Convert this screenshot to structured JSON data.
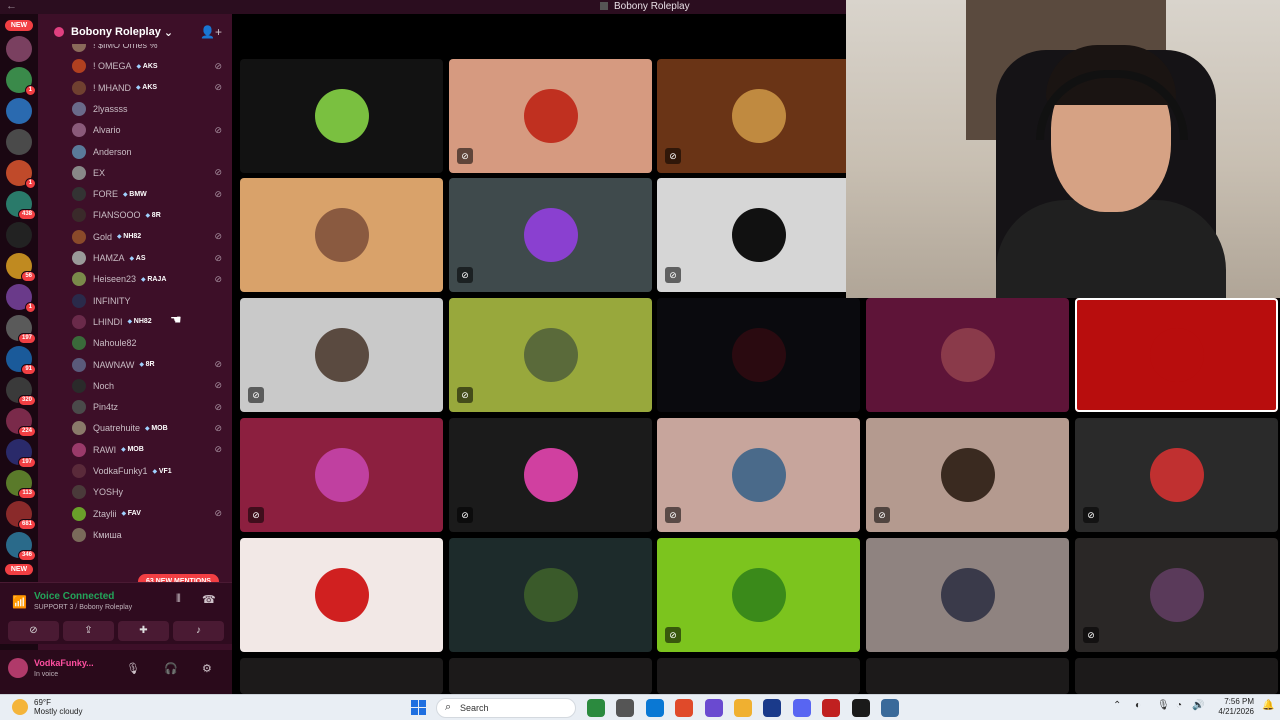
{
  "window": {
    "title": "Bobony Roleplay",
    "back_glyph": "←"
  },
  "server_rail": {
    "new_label_top": "NEW",
    "new_label_bottom": "NEW",
    "servers": [
      {
        "color": "#7a4060",
        "badge": ""
      },
      {
        "color": "#3a8a4a",
        "badge": "1"
      },
      {
        "color": "#2a6ab0",
        "badge": ""
      },
      {
        "color": "#4a4a4a",
        "badge": ""
      },
      {
        "color": "#c04a2a",
        "badge": "1"
      },
      {
        "color": "#2a7a6a",
        "badge": "438"
      },
      {
        "color": "#222222",
        "badge": ""
      },
      {
        "color": "#c08a20",
        "badge": "56"
      },
      {
        "color": "#6a3a8a",
        "badge": "1"
      },
      {
        "color": "#5a5a5a",
        "badge": "197"
      },
      {
        "color": "#1a5a9a",
        "badge": "91"
      },
      {
        "color": "#3a3a3a",
        "badge": "320"
      },
      {
        "color": "#7a2a4a",
        "badge": "224"
      },
      {
        "color": "#2a2a6a",
        "badge": "197"
      },
      {
        "color": "#5a7a2a",
        "badge": "113"
      },
      {
        "color": "#8a2a2a",
        "badge": "681"
      },
      {
        "color": "#2a6a8a",
        "badge": "346"
      }
    ]
  },
  "sidebar": {
    "server_name": "Bobony Roleplay",
    "members": [
      {
        "name": "! $IMO Ornes %",
        "tag": "",
        "muted": false,
        "color": "#8a6a5a"
      },
      {
        "name": "! OMEGA",
        "tag": "AKS",
        "muted": true,
        "color": "#b04020"
      },
      {
        "name": "! MHAND",
        "tag": "AKS",
        "muted": true,
        "color": "#704030"
      },
      {
        "name": "2lyassss",
        "tag": "",
        "muted": false,
        "color": "#6a6a8a"
      },
      {
        "name": "Alvario",
        "tag": "",
        "muted": true,
        "color": "#8a5a7a"
      },
      {
        "name": "Anderson",
        "tag": "",
        "muted": false,
        "color": "#5a7a9a"
      },
      {
        "name": "EX",
        "tag": "",
        "muted": true,
        "color": "#888888"
      },
      {
        "name": "FORE",
        "tag": "BMW",
        "muted": true,
        "color": "#333333"
      },
      {
        "name": "FIANSOOO",
        "tag": "8R",
        "muted": false,
        "color": "#3a2a2a"
      },
      {
        "name": "Gold",
        "tag": "NH82",
        "muted": true,
        "color": "#8a4a2a"
      },
      {
        "name": "HAMZA",
        "tag": "AS",
        "muted": true,
        "color": "#9a9a9a"
      },
      {
        "name": "Heiseen23",
        "tag": "RAJA",
        "muted": true,
        "color": "#7a8a4a"
      },
      {
        "name": "INFINITY",
        "tag": "",
        "muted": false,
        "color": "#2a2a4a"
      },
      {
        "name": "LHINDI",
        "tag": "NH82",
        "muted": false,
        "color": "#6a2a4a"
      },
      {
        "name": "Nahoule82",
        "tag": "",
        "muted": false,
        "color": "#3a6a3a"
      },
      {
        "name": "NAWNAW",
        "tag": "8R",
        "muted": true,
        "color": "#5a5a7a"
      },
      {
        "name": "Noch",
        "tag": "",
        "muted": true,
        "color": "#2a2a2a"
      },
      {
        "name": "Pin4tz",
        "tag": "",
        "muted": true,
        "color": "#4a4a4a"
      },
      {
        "name": "Quatrehuite",
        "tag": "MOB",
        "muted": true,
        "color": "#8a7a6a"
      },
      {
        "name": "RAWI",
        "tag": "MOB",
        "muted": true,
        "color": "#9a3a6a"
      },
      {
        "name": "VodkaFunky1",
        "tag": "VF1",
        "muted": false,
        "color": "#5a2a3a"
      },
      {
        "name": "YOSHy",
        "tag": "",
        "muted": false,
        "color": "#4a3a3a"
      },
      {
        "name": "Ztaylii",
        "tag": "FAV",
        "muted": true,
        "color": "#6aa02a"
      },
      {
        "name": "Кмиша",
        "tag": "",
        "muted": false,
        "color": "#7a6a5a"
      }
    ],
    "mentions_label": "63 NEW MENTIONS"
  },
  "voice": {
    "status": "Voice Connected",
    "channel": "SUPPORT 3 / Bobony Roleplay"
  },
  "user": {
    "name": "VodkaFunky...",
    "status": "In voice"
  },
  "tiles": [
    {
      "bg": "#121212",
      "avatar": "#7ac040",
      "muted": false
    },
    {
      "bg": "#d69a80",
      "avatar": "#c03020",
      "muted": true
    },
    {
      "bg": "#6a3416",
      "avatar": "#c08a40",
      "muted": true
    },
    {
      "bg": "#d9a26a",
      "avatar": "#8a5a40",
      "muted": false
    },
    {
      "bg": "#3f4a4c",
      "avatar": "#8a40d0",
      "muted": true
    },
    {
      "bg": "#d6d6d6",
      "avatar": "#111111",
      "muted": true
    },
    {
      "bg": "#c9c9c9",
      "avatar": "#5a4a40",
      "muted": true
    },
    {
      "bg": "#98a83c",
      "avatar": "#5a6a3a",
      "muted": true
    },
    {
      "bg": "#0a0a0e",
      "avatar": "#2a0a10",
      "muted": false
    },
    {
      "bg": "#5e1438",
      "avatar": "#8a3a4a",
      "muted": false
    },
    {
      "bg": "#b80d0d",
      "avatar": "#b80d0d",
      "muted": false,
      "selected": true
    },
    {
      "bg": "#8c1f3f",
      "avatar": "#c040a0",
      "muted": true
    },
    {
      "bg": "#1b1b1b",
      "avatar": "#d040a0",
      "muted": true
    },
    {
      "bg": "#c7a59c",
      "avatar": "#4a6a8a",
      "muted": true
    },
    {
      "bg": "#b49a8f",
      "avatar": "#3a2a20",
      "muted": true
    },
    {
      "bg": "#2a2a2a",
      "avatar": "#c03030",
      "muted": true
    },
    {
      "bg": "#f2e8e6",
      "avatar": "#d02020",
      "muted": false
    },
    {
      "bg": "#1d2b2b",
      "avatar": "#3a5a2a",
      "muted": false
    },
    {
      "bg": "#7cc41e",
      "avatar": "#3a8a1a",
      "muted": true
    },
    {
      "bg": "#8f8380",
      "avatar": "#3a3a4a",
      "muted": false
    },
    {
      "bg": "#2a2726",
      "avatar": "#5a3a5a",
      "muted": true
    }
  ],
  "taskbar": {
    "temperature": "69°F",
    "weather": "Mostly cloudy",
    "search_label": "Search",
    "time": "7:56 PM",
    "date": "4/21/2026",
    "apps": [
      "#2b8a3e",
      "#555555",
      "#0a78d4",
      "#e04a2a",
      "#6a4ad0",
      "#f0b030",
      "#1a3a8a",
      "#5865f2",
      "#c02020",
      "#1a1a1a",
      "#3a6a9a"
    ]
  }
}
